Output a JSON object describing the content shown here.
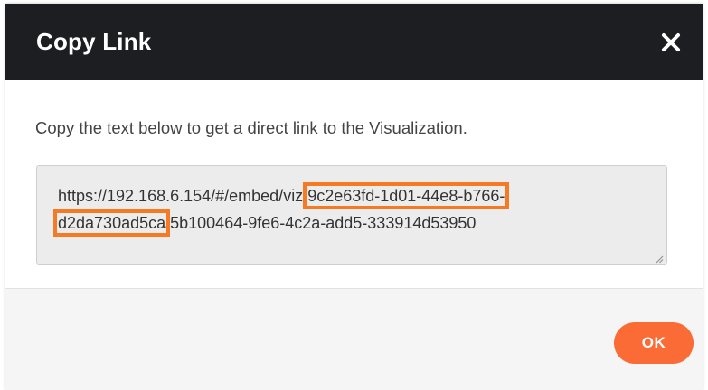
{
  "dialog": {
    "title": "Copy Link",
    "close_icon": "close-icon",
    "instructions": "Copy the text below to get a direct link to the Visualization.",
    "url": {
      "line1_prefix": "https://192.168.6.154/#/embed/viz/",
      "line1_highlight": "9c2e63fd-1d01-44e8-b766-",
      "line2_highlight": "d2da730ad5ca",
      "line2_suffix": "/5b100464-9fe6-4c2a-add5-333914d53950"
    },
    "ok_label": "OK"
  },
  "colors": {
    "header_bg": "#1c1e22",
    "highlight_outline": "#f57a23",
    "ok_button_bg": "#fa6b35",
    "textarea_bg": "#ececec",
    "footer_bg": "#f5f5f5"
  }
}
